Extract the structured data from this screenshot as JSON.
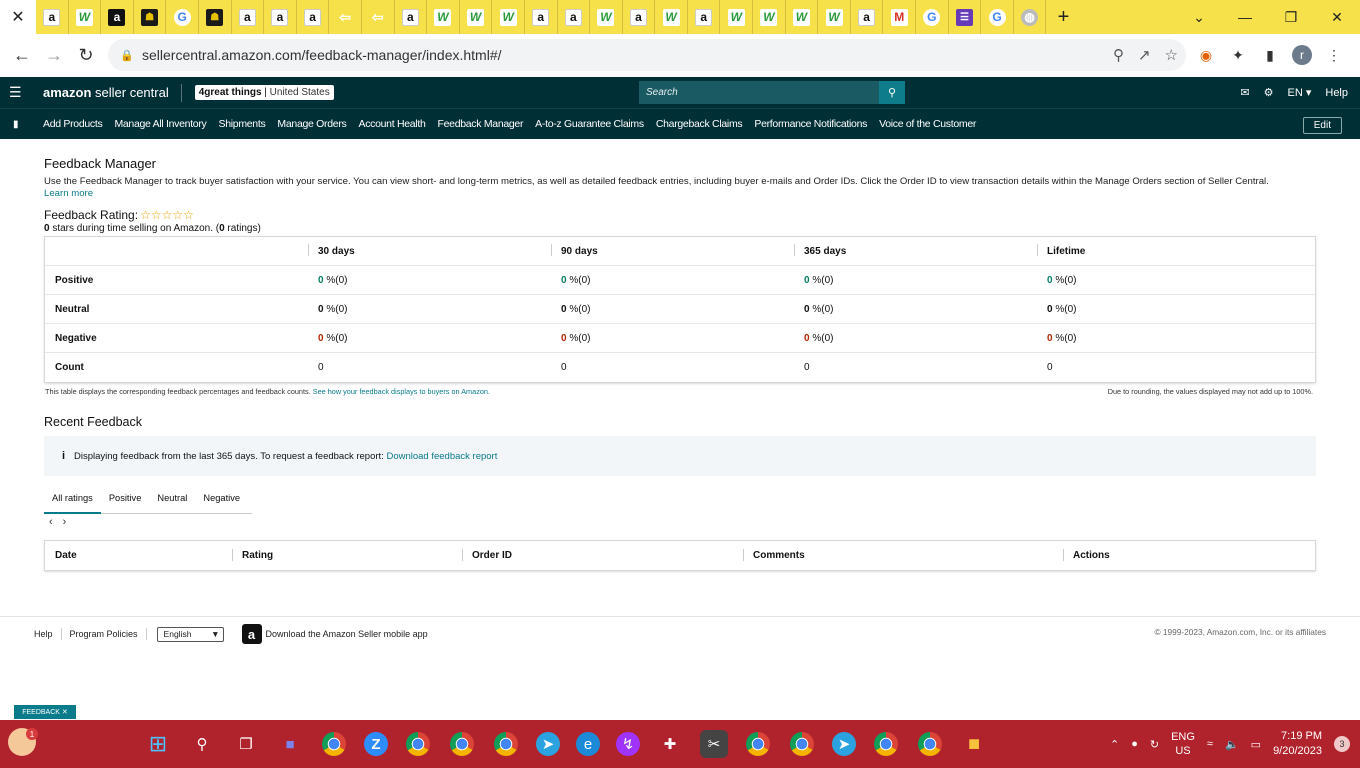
{
  "browser": {
    "active_tab_close": "✕",
    "new_tab": "+",
    "favicons": [
      {
        "name": "amazon-favicon",
        "glyph": "a",
        "kind": "fav-amazon"
      },
      {
        "name": "w-favicon",
        "glyph": "W",
        "kind": "fav-w"
      },
      {
        "name": "amazon-favicon",
        "glyph": "a",
        "kind": "fav-dark"
      },
      {
        "name": "dark-favicon",
        "glyph": "☗",
        "kind": "fav-dark2"
      },
      {
        "name": "google-favicon",
        "glyph": "G",
        "kind": "fav-g"
      },
      {
        "name": "dark-favicon",
        "glyph": "☗",
        "kind": "fav-dark2"
      },
      {
        "name": "amazon-favicon",
        "glyph": "a",
        "kind": "fav-amazon"
      },
      {
        "name": "amazon-favicon",
        "glyph": "a",
        "kind": "fav-amazon"
      },
      {
        "name": "amazon-favicon",
        "glyph": "a",
        "kind": "fav-amazon"
      },
      {
        "name": "arrow-favicon",
        "glyph": "⇦",
        "kind": "fav-yellow"
      },
      {
        "name": "arrow-favicon",
        "glyph": "⇦",
        "kind": "fav-yellow"
      },
      {
        "name": "amazon-favicon",
        "glyph": "a",
        "kind": "fav-amazon"
      },
      {
        "name": "w-favicon",
        "glyph": "W",
        "kind": "fav-w"
      },
      {
        "name": "w-favicon",
        "glyph": "W",
        "kind": "fav-w"
      },
      {
        "name": "w-favicon",
        "glyph": "W",
        "kind": "fav-w"
      },
      {
        "name": "amazon-favicon",
        "glyph": "a",
        "kind": "fav-amazon"
      },
      {
        "name": "amazon-favicon",
        "glyph": "a",
        "kind": "fav-amazon"
      },
      {
        "name": "w-favicon",
        "glyph": "W",
        "kind": "fav-w"
      },
      {
        "name": "amazon-favicon",
        "glyph": "a",
        "kind": "fav-amazon"
      },
      {
        "name": "w-favicon",
        "glyph": "W",
        "kind": "fav-w"
      },
      {
        "name": "amazon-favicon",
        "glyph": "a",
        "kind": "fav-amazon"
      },
      {
        "name": "w-favicon",
        "glyph": "W",
        "kind": "fav-w"
      },
      {
        "name": "w-favicon",
        "glyph": "W",
        "kind": "fav-w"
      },
      {
        "name": "w-favicon",
        "glyph": "W",
        "kind": "fav-w"
      },
      {
        "name": "w-favicon",
        "glyph": "W",
        "kind": "fav-w"
      },
      {
        "name": "amazon-favicon",
        "glyph": "a",
        "kind": "fav-amazon"
      },
      {
        "name": "gmail-favicon",
        "glyph": "M",
        "kind": "fav-m"
      },
      {
        "name": "google-favicon",
        "glyph": "G",
        "kind": "fav-g"
      },
      {
        "name": "forms-favicon",
        "glyph": "☰",
        "kind": "fav-form"
      },
      {
        "name": "google-favicon",
        "glyph": "G",
        "kind": "fav-g"
      },
      {
        "name": "globe-favicon",
        "glyph": "◍",
        "kind": "fav-grey"
      }
    ],
    "window_controls": [
      "⌄",
      "—",
      "❐",
      "✕"
    ],
    "url": "sellercentral.amazon.com/feedback-manager/index.html#/"
  },
  "header": {
    "logo_bold": "amazon",
    "logo_rest": " seller central",
    "store_name": "4great things",
    "store_region": "United States",
    "search_placeholder": "Search",
    "language": "EN",
    "help": "Help"
  },
  "nav": {
    "items": [
      "Add Products",
      "Manage All Inventory",
      "Shipments",
      "Manage Orders",
      "Account Health",
      "Feedback Manager",
      "A-to-z Guarantee Claims",
      "Chargeback Claims",
      "Performance Notifications",
      "Voice of the Customer"
    ],
    "edit": "Edit"
  },
  "page": {
    "title": "Feedback Manager",
    "description": "Use the Feedback Manager to track buyer satisfaction with your service. You can view short- and long-term metrics, as well as detailed feedback entries, including buyer e-mails and Order IDs. Click the Order ID to view transaction details within the Manage Orders section of Seller Central.",
    "learn_more": "Learn more",
    "rating_label": "Feedback Rating:",
    "stars": "☆☆☆☆☆",
    "stars_value": "0",
    "stars_text_mid": " stars during time selling on Amazon. (",
    "ratings_count": "0",
    "stars_text_end": " ratings)"
  },
  "feedback_table": {
    "columns": [
      "30 days",
      "90 days",
      "365 days",
      "Lifetime"
    ],
    "rows": [
      {
        "label": "Positive",
        "kind": "zpos",
        "cells": [
          [
            "0",
            " %(0)"
          ],
          [
            "0",
            " %(0)"
          ],
          [
            "0",
            " %(0)"
          ],
          [
            "0",
            " %(0)"
          ]
        ]
      },
      {
        "label": "Neutral",
        "kind": "",
        "cells": [
          [
            "0",
            " %(0)"
          ],
          [
            "0",
            " %(0)"
          ],
          [
            "0",
            " %(0)"
          ],
          [
            "0",
            " %(0)"
          ]
        ]
      },
      {
        "label": "Negative",
        "kind": "zneg",
        "cells": [
          [
            "0",
            " %(0)"
          ],
          [
            "0",
            " %(0)"
          ],
          [
            "0",
            " %(0)"
          ],
          [
            "0",
            " %(0)"
          ]
        ]
      },
      {
        "label": "Count",
        "kind": "count",
        "cells": [
          [
            "0",
            ""
          ],
          [
            "0",
            ""
          ],
          [
            "0",
            ""
          ],
          [
            "0",
            ""
          ]
        ]
      }
    ],
    "note": "This table displays the corresponding feedback percentages and feedback counts.",
    "note_link": "See how your feedback displays to buyers on Amazon.",
    "rounding_note": "Due to rounding, the values displayed may not add up to 100%."
  },
  "recent": {
    "title": "Recent Feedback",
    "info_icon": "i",
    "info_text": "Displaying feedback from the last 365 days. To request a feedback report: ",
    "download_link": "Download feedback report",
    "tabs": [
      "All ratings",
      "Positive",
      "Neutral",
      "Negative"
    ],
    "prev": "‹",
    "next": "›",
    "columns": [
      "Date",
      "Rating",
      "Order ID",
      "Comments",
      "Actions"
    ]
  },
  "footer": {
    "help": "Help",
    "policies": "Program Policies",
    "language": "English",
    "app_text": "Download the Amazon Seller mobile app",
    "copyright": "© 1999-2023, Amazon.com, Inc. or its affiliates"
  },
  "feedback_tab": "FEEDBACK ✕",
  "taskbar": {
    "weather_badge": "1",
    "lang_top": "ENG",
    "lang_bottom": "US",
    "time": "7:19 PM",
    "date": "9/20/2023",
    "notifications": "3"
  }
}
